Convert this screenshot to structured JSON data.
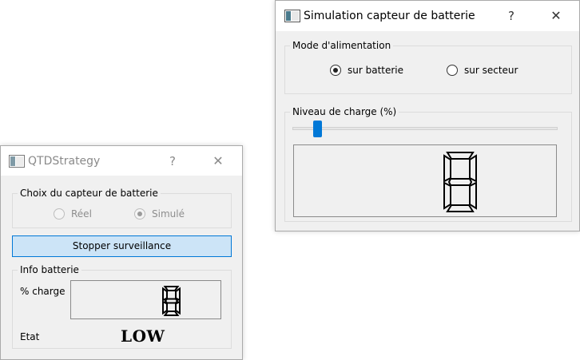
{
  "left_window": {
    "title": "QTDStrategy",
    "help_button": "?",
    "close_button": "✕",
    "sensor_group": {
      "title": "Choix du capteur de batterie",
      "options": [
        {
          "label": "Réel",
          "selected": false
        },
        {
          "label": "Simulé",
          "selected": true
        }
      ]
    },
    "stop_button": "Stopper surveillance",
    "info_group": {
      "title": "Info batterie",
      "charge_label": "% charge",
      "charge_value": "8",
      "state_label": "Etat",
      "state_value": "LOW"
    }
  },
  "right_window": {
    "title": "Simulation capteur de batterie",
    "help_button": "?",
    "close_button": "✕",
    "power_group": {
      "title": "Mode d'alimentation",
      "options": [
        {
          "label": "sur batterie",
          "selected": true
        },
        {
          "label": "sur secteur",
          "selected": false
        }
      ]
    },
    "charge_group": {
      "title": "Niveau de charge (%)",
      "slider_value": 8,
      "slider_min": 0,
      "slider_max": 100,
      "display_value": "8"
    }
  },
  "colors": {
    "accent": "#0078d7",
    "button_bg": "#cce4f7",
    "lcd_segment": "#000000"
  }
}
